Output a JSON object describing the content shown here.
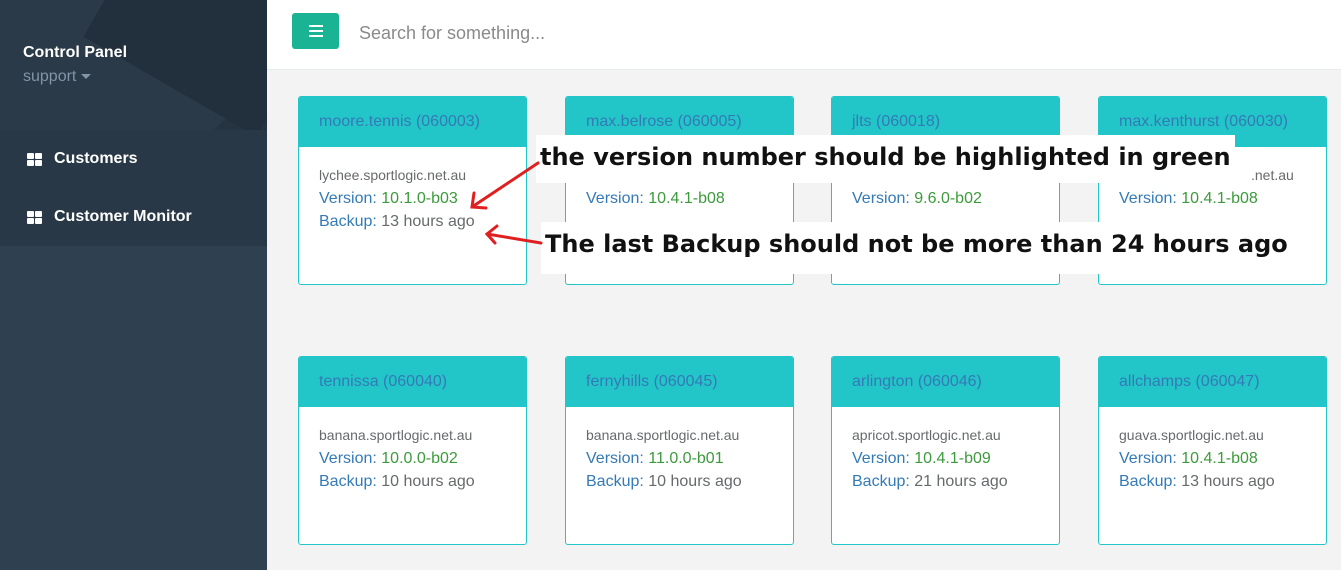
{
  "sidebar": {
    "title": "Control Panel",
    "subtitle": "support",
    "items": [
      {
        "label": "Customers",
        "icon": "grid-icon"
      },
      {
        "label": "Customer Monitor",
        "icon": "grid-icon"
      }
    ]
  },
  "topbar": {
    "menu_icon": "hamburger-icon",
    "search_placeholder": "Search for something..."
  },
  "labels": {
    "version": "Version:",
    "backup": "Backup:"
  },
  "cards": [
    {
      "title": "moore.tennis (060003)",
      "host": "lychee.sportlogic.net.au",
      "version": "10.1.0-b03",
      "backup": "13 hours ago"
    },
    {
      "title": "max.belrose (060005)",
      "host": "",
      "version": "10.4.1-b08",
      "backup": ""
    },
    {
      "title": "jlts (060018)",
      "host": "",
      "version": "9.6.0-b02",
      "backup": ""
    },
    {
      "title": "max.kenthurst (060030)",
      "host": ".net.au",
      "version": "10.4.1-b08",
      "backup": ""
    },
    {
      "title": "tennissa (060040)",
      "host": "banana.sportlogic.net.au",
      "version": "10.0.0-b02",
      "backup": "10 hours ago"
    },
    {
      "title": "fernyhills (060045)",
      "host": "banana.sportlogic.net.au",
      "version": "11.0.0-b01",
      "backup": "10 hours ago"
    },
    {
      "title": "arlington (060046)",
      "host": "apricot.sportlogic.net.au",
      "version": "10.4.1-b09",
      "backup": "21 hours ago"
    },
    {
      "title": "allchamps (060047)",
      "host": "guava.sportlogic.net.au",
      "version": "10.4.1-b08",
      "backup": "13 hours ago"
    }
  ],
  "annotations": {
    "version_note": "the version number should be highlighted in green",
    "backup_note": "The last Backup should not be more than 24 hours ago",
    "arrow_color": "#e02020"
  },
  "colors": {
    "accent": "#23c6c8",
    "button": "#1ab394",
    "sidebar": "#2f4050",
    "link": "#337ab7",
    "version_green": "#3c9a3c"
  }
}
